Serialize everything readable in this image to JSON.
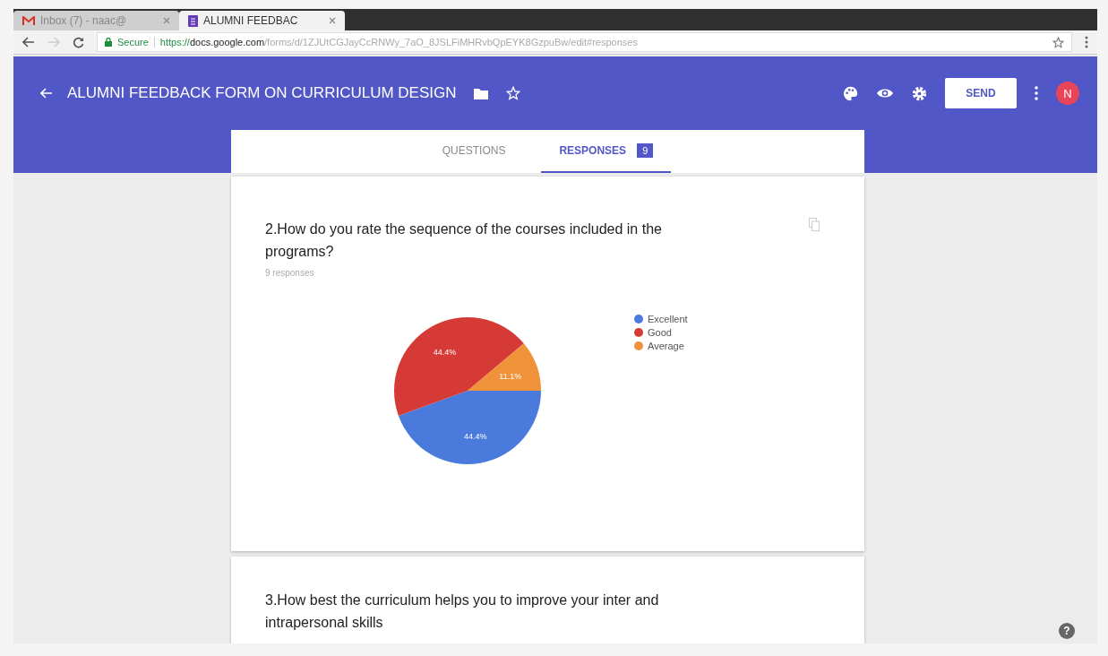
{
  "browser": {
    "tabs": [
      {
        "title": "Inbox (7) - naac@",
        "kind": "mail",
        "selected": false
      },
      {
        "title": "ALUMNI FEEDBAC",
        "kind": "form",
        "selected": true
      }
    ],
    "address": {
      "security": "Secure",
      "scheme": "https://",
      "host": "docs.google.com",
      "path": "/forms/d/1ZJUtCGJayCcRNWy_7aO_8JSLFiMHRvbQpEYK8GzpuBw/edit#responses"
    }
  },
  "header": {
    "title": "ALUMNI FEEDBACK FORM ON CURRICULUM DESIGN",
    "send": "SEND",
    "avatar": "N"
  },
  "form_tabs": [
    {
      "label": "QUESTIONS",
      "selected": false
    },
    {
      "label": "RESPONSES",
      "selected": true,
      "badge": "9"
    }
  ],
  "questions": [
    {
      "title": "2.How do you rate the sequence of the courses included in the programs?",
      "responses": "9 responses",
      "chart_data": {
        "type": "pie",
        "categories": [
          "Excellent",
          "Good",
          "Average"
        ],
        "values": [
          44.4,
          44.4,
          11.1
        ],
        "value_labels": [
          "44.4%",
          "44.4%",
          "11.1%"
        ]
      },
      "legend": [
        {
          "color": "#4a7bdc"
        },
        {
          "color": "#d63a36"
        },
        {
          "color": "#f0923a"
        }
      ]
    },
    {
      "title": "3.How best the curriculum helps you to improve your inter and intrapersonal skills"
    }
  ],
  "help": "?"
}
